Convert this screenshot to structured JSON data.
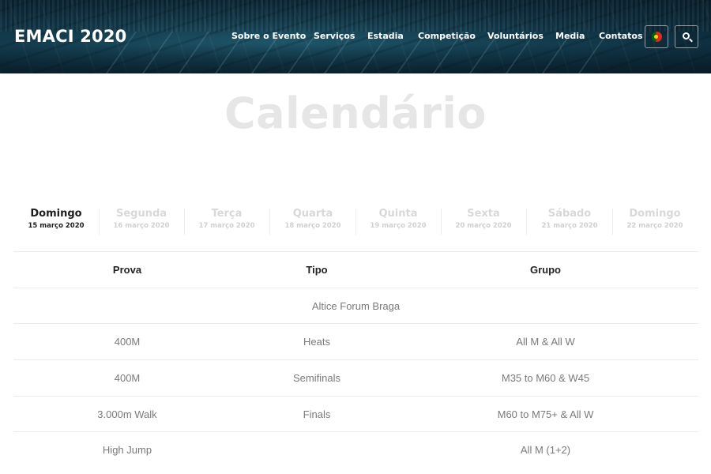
{
  "header": {
    "logo": "EMACI 2020",
    "nav": [
      {
        "label": "Sobre o Evento"
      },
      {
        "label": "Serviços"
      },
      {
        "label": "Estadia"
      },
      {
        "label": "Competição"
      },
      {
        "label": "Voluntários"
      },
      {
        "label": "Media"
      },
      {
        "label": "Contatos"
      }
    ],
    "language_icon": "portugal-flag-icon",
    "search_icon": "search-icon"
  },
  "page": {
    "title": "Calendário"
  },
  "days": [
    {
      "day": "Domingo",
      "date": "15 março 2020",
      "active": true
    },
    {
      "day": "Segunda",
      "date": "16 março 2020",
      "active": false
    },
    {
      "day": "Terça",
      "date": "17 março 2020",
      "active": false
    },
    {
      "day": "Quarta",
      "date": "18 março 2020",
      "active": false
    },
    {
      "day": "Quinta",
      "date": "19 março 2020",
      "active": false
    },
    {
      "day": "Sexta",
      "date": "20 março 2020",
      "active": false
    },
    {
      "day": "Sábado",
      "date": "21 março 2020",
      "active": false
    },
    {
      "day": "Domingo",
      "date": "22 março 2020",
      "active": false
    }
  ],
  "table": {
    "headers": [
      "Prova",
      "Tipo",
      "Grupo"
    ],
    "venue": "Altice Forum Braga",
    "rows": [
      [
        "400M",
        "Heats",
        "All M & All W"
      ],
      [
        "400M",
        "Semifinals",
        "M35 to M60 & W45"
      ],
      [
        "3.000m Walk",
        "Finals",
        "M60 to M75+ & All W"
      ],
      [
        "High Jump",
        "",
        "All M (1+2)"
      ]
    ]
  },
  "colors": {
    "header_bg": "#1c4f63",
    "title": "#e6e6e6",
    "active_tab": "#1d1d1d",
    "inactive_tab": "#d8d8d8",
    "cell_text": "#7a7a7a",
    "row_border": "#ebebeb"
  }
}
